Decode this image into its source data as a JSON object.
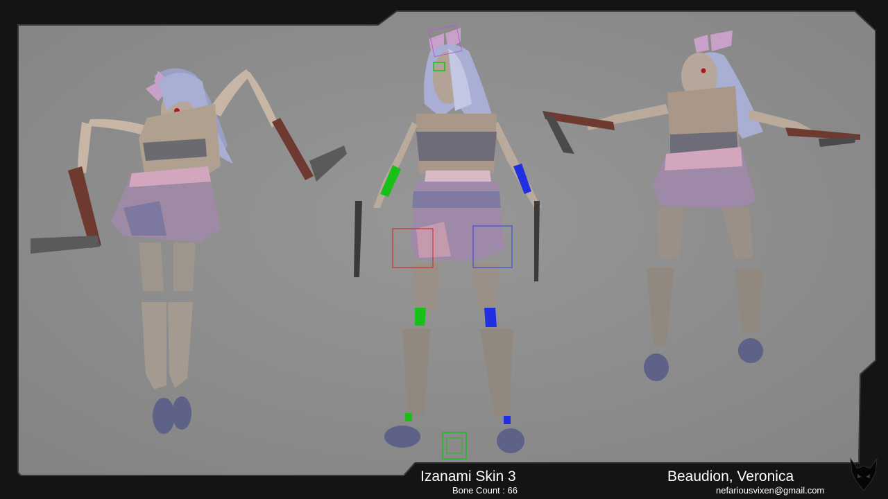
{
  "captions": {
    "title": "Izanami Skin 3",
    "bone_count": "Bone Count : 66",
    "author": "Beaudion, Veronica",
    "email": "nefariousvixen@gmail.com"
  },
  "colors": {
    "viewport": "#8e8e8e",
    "frame": "#141414",
    "frame_edge": "#3a3a3a",
    "text": "#ffffff",
    "rig_left": "#18c018",
    "rig_right": "#2030e0"
  },
  "icons": {
    "logo": "horned-demon-logo-icon"
  }
}
